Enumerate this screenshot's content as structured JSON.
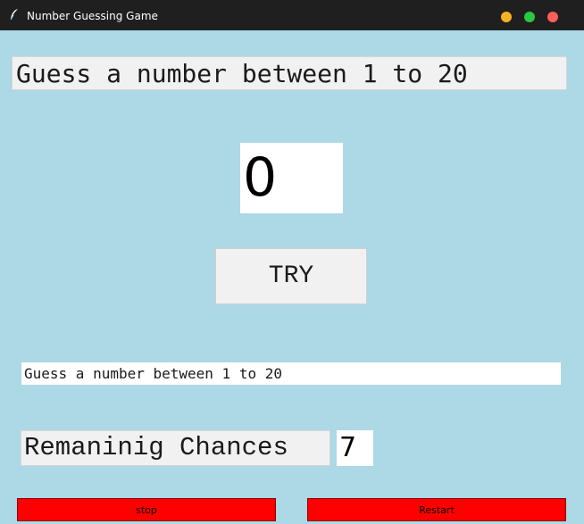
{
  "window": {
    "title": "Number Guessing Game",
    "icon": "feather-icon"
  },
  "heading": "Guess a number between 1 to 20",
  "guess_input": {
    "value": "0"
  },
  "try_button": {
    "label": "TRY"
  },
  "message": "Guess a number between 1 to 20",
  "chances": {
    "label": "Remaninig Chances",
    "value": "7"
  },
  "buttons": {
    "stop_label": "stop",
    "restart_label": "Restart"
  },
  "colors": {
    "background": "#add8e6",
    "action_button": "#ff0000",
    "titlebar": "#1f1f1f",
    "minimize": "#f5b120",
    "maximize": "#27c93f",
    "close": "#ff5f57"
  }
}
